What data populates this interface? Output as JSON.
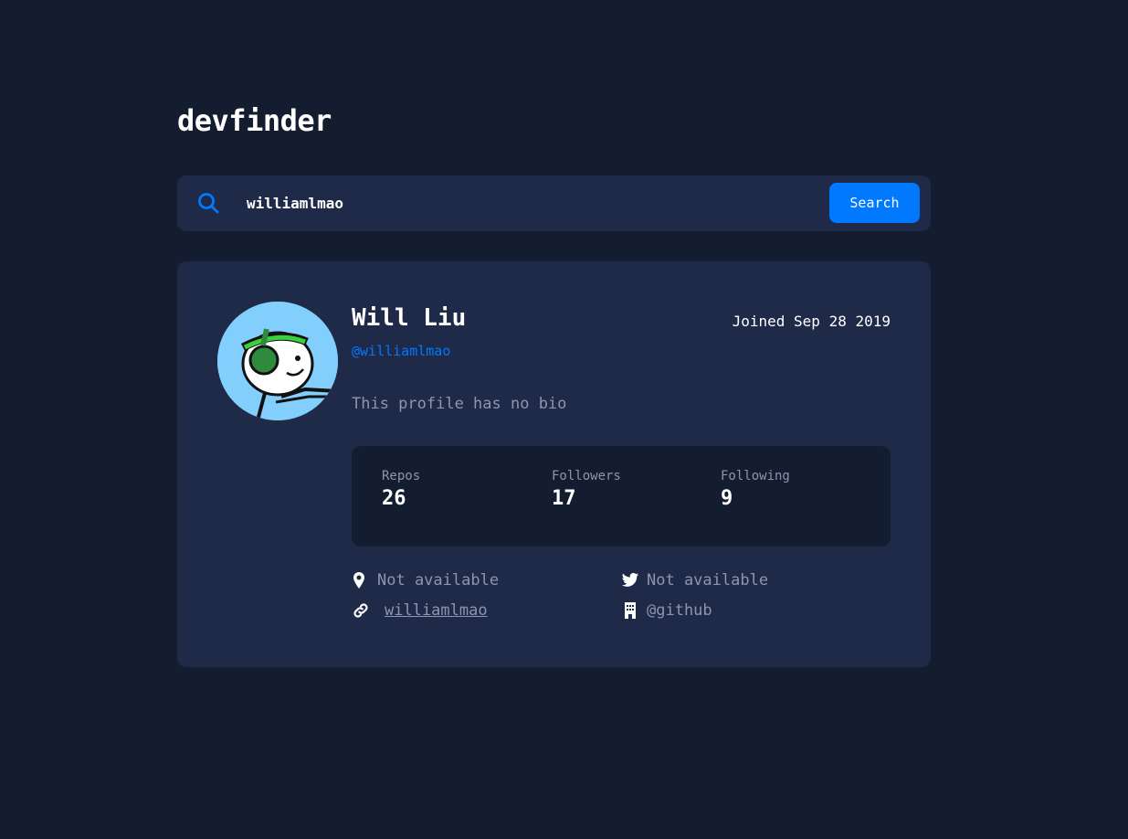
{
  "app": {
    "title": "devfinder"
  },
  "search": {
    "value": "williamlmao",
    "button_label": "Search",
    "icon": "search-icon"
  },
  "profile": {
    "name": "Will Liu",
    "login": "@williamlmao",
    "joined": "Joined Sep 28 2019",
    "bio": "This profile has no bio",
    "avatar": "avatar-image"
  },
  "stats": {
    "repos_label": "Repos",
    "repos_value": "26",
    "followers_label": "Followers",
    "followers_value": "17",
    "following_label": "Following",
    "following_value": "9"
  },
  "links": {
    "location": "Not available",
    "twitter": "Not available",
    "blog": "williamlmao",
    "company": "@github"
  },
  "colors": {
    "background": "#141c2f",
    "card": "#1f2a48",
    "accent": "#0079ff",
    "muted": "#8d96ac",
    "text": "#ffffff"
  }
}
